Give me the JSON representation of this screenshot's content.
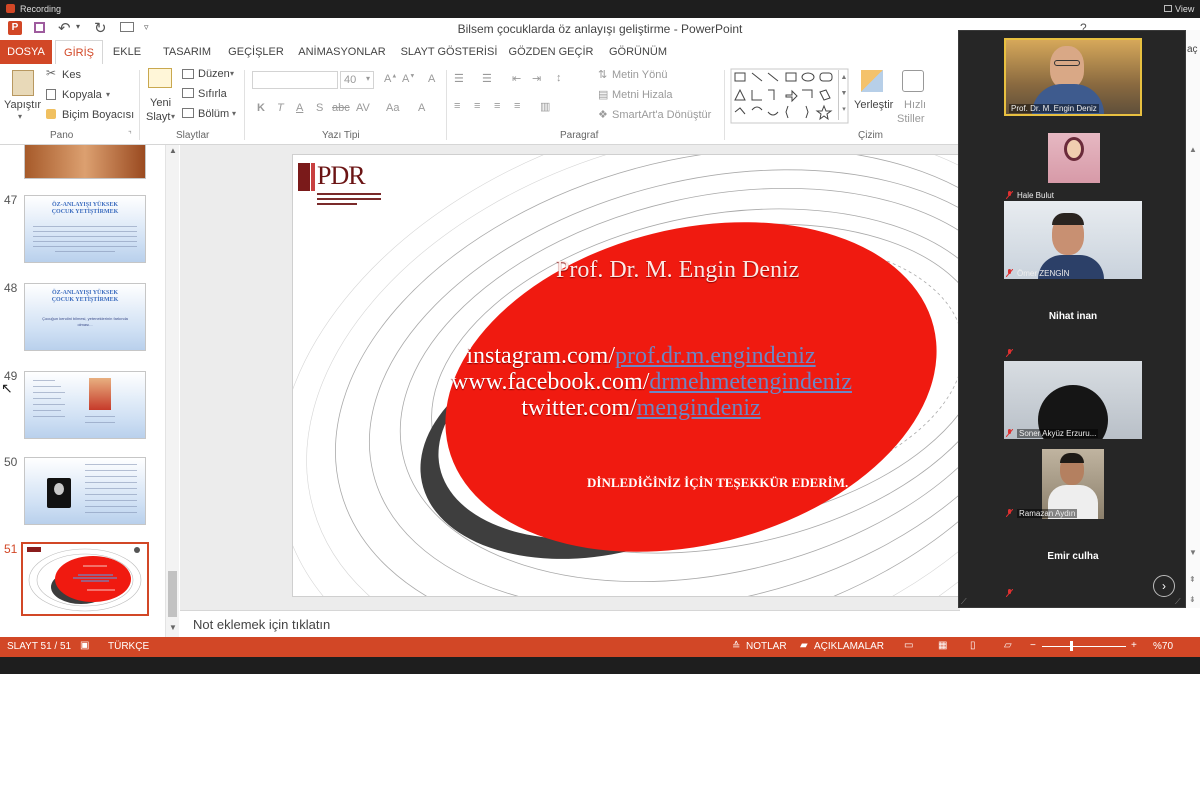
{
  "recording": {
    "label": "Recording",
    "view_label": "View"
  },
  "window": {
    "title": "Bilsem çocuklarda öz anlayışı geliştirme - PowerPoint",
    "help": "?",
    "right_label": "aç"
  },
  "tabs": [
    "DOSYA",
    "GİRİŞ",
    "EKLE",
    "TASARIM",
    "GEÇİŞLER",
    "ANİMASYONLAR",
    "SLAYT GÖSTERİSİ",
    "GÖZDEN GEÇİR",
    "GÖRÜNÜM"
  ],
  "ribbon": {
    "pano": {
      "paste": "Yapıştır",
      "cut": "Kes",
      "copy": "Kopyala",
      "format_painter": "Biçim Boyacısı",
      "label": "Pano"
    },
    "slides": {
      "new_slide_1": "Yeni",
      "new_slide_2": "Slayt",
      "layout": "Düzen",
      "reset": "Sıfırla",
      "section": "Bölüm",
      "label": "Slaytlar"
    },
    "font": {
      "size": "40",
      "bold": "K",
      "italic": "T",
      "underline": "A",
      "strike": "S",
      "spacing": "abc",
      "spacing2": "AV",
      "case": "Aa",
      "color": "A",
      "label": "Yazı Tipi"
    },
    "paragraph": {
      "text_direction": "Metin Yönü",
      "align_text": "Metni Hizala",
      "smartart": "SmartArt'a Dönüştür",
      "label": "Paragraf"
    },
    "drawing": {
      "arrange": "Yerleştir",
      "quick_styles_1": "Hızlı",
      "quick_styles_2": "Stiller",
      "label": "Çizim"
    }
  },
  "thumbnails": [
    {
      "number": "47",
      "title": "ÖZ-ANLAYIŞI YÜKSEK ÇOCUK YETİŞTİRMEK"
    },
    {
      "number": "48",
      "title": "ÖZ-ANLAYIŞI YÜKSEK ÇOCUK YETİŞTİRMEK",
      "text": "Çocuğun kendini bilmesi, yeteneklerinin farkında olması..."
    },
    {
      "number": "49"
    },
    {
      "number": "50"
    },
    {
      "number": "51"
    }
  ],
  "slide": {
    "logo": "PDR",
    "name": "Prof. Dr. M. Engin Deniz",
    "links": [
      {
        "prefix": "instagram.com/",
        "handle": "prof.dr.m.engindeniz"
      },
      {
        "prefix": "www.facebook.com/",
        "handle": "drmehmetengindeniz"
      },
      {
        "prefix": "twitter.com/",
        "handle": "mengindeniz"
      }
    ],
    "thanks": "DİNLEDİĞİNİZ İÇİN TEŞEKKÜR EDERİM."
  },
  "notes_placeholder": "Not eklemek için tıklatın",
  "status": {
    "slide": "SLAYT 51 / 51",
    "language": "TÜRKÇE",
    "notes": "NOTLAR",
    "comments": "AÇIKLAMALAR",
    "zoom": "%70"
  },
  "participants": [
    {
      "name": "Prof. Dr. M. Engin Deniz",
      "video": true
    },
    {
      "name": "Hale Bulut",
      "video": true
    },
    {
      "name": "Ömer ZENGİN",
      "video": true
    },
    {
      "name": "Nihat inan",
      "video": false
    },
    {
      "name": "Soner Akyüz Erzuru...",
      "video": true
    },
    {
      "name": "Ramazan Aydın",
      "video": true
    },
    {
      "name": "Emir culha",
      "video": false
    }
  ],
  "colors": {
    "accent": "#d24726",
    "slide_red": "#f01a10",
    "link_blue": "#6d86c4",
    "video_bg": "#262626",
    "active_border": "#e8c040"
  }
}
